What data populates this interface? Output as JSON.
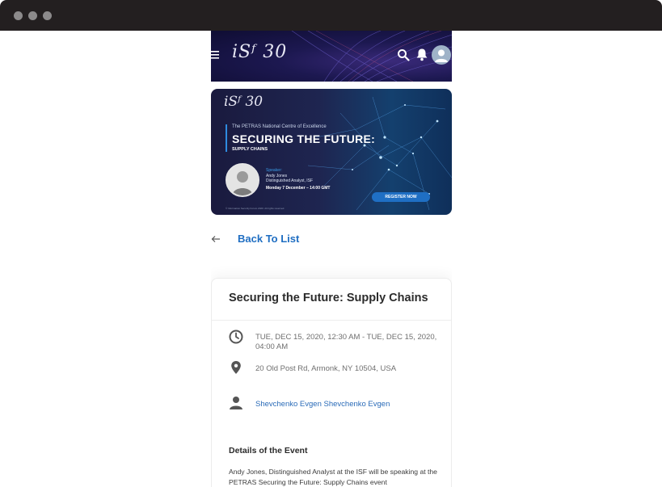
{
  "header": {
    "logo": "iSᶠ 30",
    "icons": [
      "menu-icon",
      "search-icon",
      "bell-icon",
      "user-avatar-icon"
    ]
  },
  "banner": {
    "logo": "iSᶠ 30",
    "kicker": "The PETRAS National Centre of Excellence",
    "title": "SECURING THE FUTURE:",
    "subtitle": "SUPPLY CHAINS",
    "speaker_label": "Speaker:",
    "speaker_name": "Andy Jones",
    "speaker_role": "Distinguished Analyst, ISF",
    "date": "Monday 7 December – 14:00 GMT",
    "register": "REGISTER NOW",
    "fine_print": "© Information Security Forum 2020. All rights reserved."
  },
  "nav": {
    "back_label": "Back To List"
  },
  "event": {
    "title": "Securing the Future: Supply Chains",
    "datetime": "TUE, DEC 15, 2020, 12:30 AM - TUE, DEC 15, 2020, 04:00 AM",
    "location": "20 Old Post Rd, Armonk, NY 10504, USA",
    "organizer": "Shevchenko Evgen Shevchenko Evgen",
    "details_heading": "Details of the Event",
    "details_text": "Andy Jones, Distinguished Analyst at the ISF will be speaking at the PETRAS Securing the Future: Supply Chains event"
  },
  "colors": {
    "link": "#1f6ec2",
    "header_bg": "#1c1850",
    "register_btn": "#1f6fc4"
  }
}
